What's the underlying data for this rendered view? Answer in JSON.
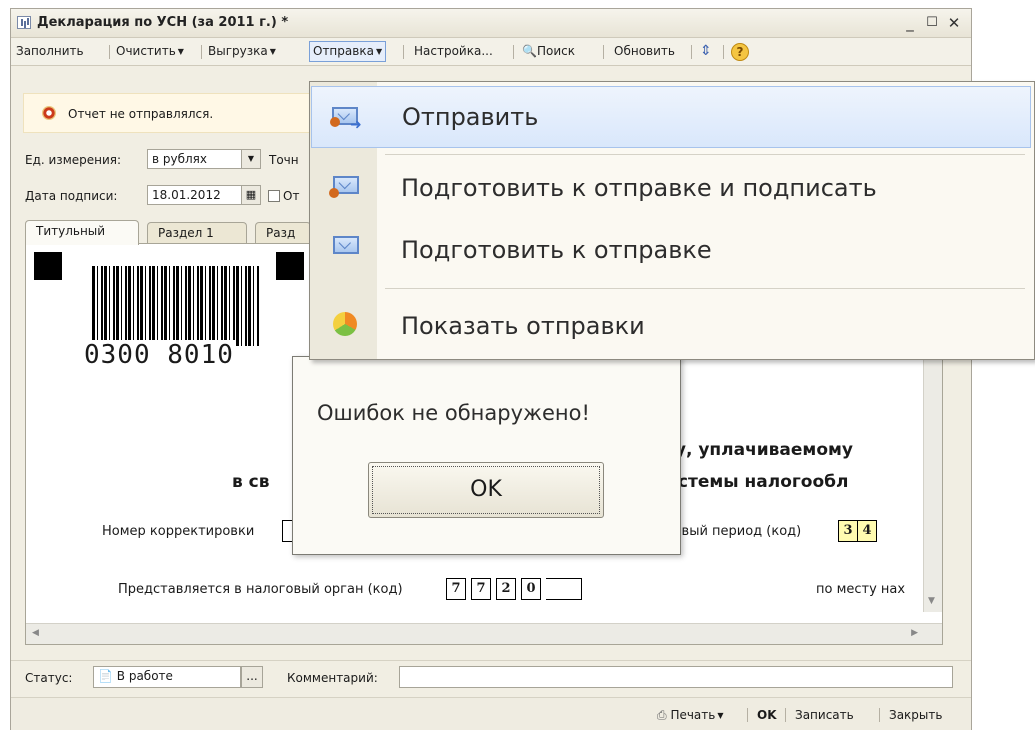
{
  "window": {
    "title": "Декларация по УСН (за 2011 г.) *",
    "controls": [
      "_",
      "☐",
      "✕"
    ]
  },
  "toolbar": {
    "fill": "Заполнить",
    "clear": "Очистить",
    "export": "Выгрузка",
    "send": "Отправка",
    "settings": "Настройка...",
    "search": "Поиск",
    "refresh": "Обновить",
    "help": "?"
  },
  "notice": {
    "text": "Отчет не отправлялся."
  },
  "form": {
    "units_label": "Ед. измерения:",
    "units_value": "в рублях",
    "precision_label": "Точн",
    "sign_date_label": "Дата подписи:",
    "sign_date_value": "18.01.2012",
    "checkbox_label": "От"
  },
  "tabs": [
    {
      "label": "Титульный"
    },
    {
      "label": "Раздел 1"
    },
    {
      "label": "Разд"
    }
  ],
  "document": {
    "barcode_number": "0300 8010",
    "heading_1": "гу, уплачиваемому",
    "heading_2_left": "в св",
    "heading_2_right": "истемы налогообл",
    "correction_label": "Номер корректировки",
    "tax_period_label": "товый период (код)",
    "tax_period_code": [
      "3",
      "4"
    ],
    "authority_label": "Представляется в налоговый орган (код)",
    "authority_code": [
      "7",
      "7",
      "2",
      "0"
    ],
    "location_label": "по месту нах"
  },
  "status": {
    "label": "Статус:",
    "value": "В работе",
    "more": "...",
    "comment_label": "Комментарий:"
  },
  "bottom": {
    "print": "Печать",
    "ok": "OK",
    "save": "Записать",
    "close": "Закрыть"
  },
  "send_menu": {
    "items": [
      {
        "label": "Отправить",
        "icon": "envelope-send-icon",
        "highlighted": true
      },
      {
        "label": "Подготовить к отправке и подписать",
        "icon": "envelope-sign-icon"
      },
      {
        "label": "Подготовить к отправке",
        "icon": "envelope-icon"
      },
      {
        "label": "Показать отправки",
        "icon": "sent-list-icon"
      }
    ]
  },
  "dialog": {
    "message": "Ошибок не обнаружено!",
    "ok_label": "OK"
  }
}
